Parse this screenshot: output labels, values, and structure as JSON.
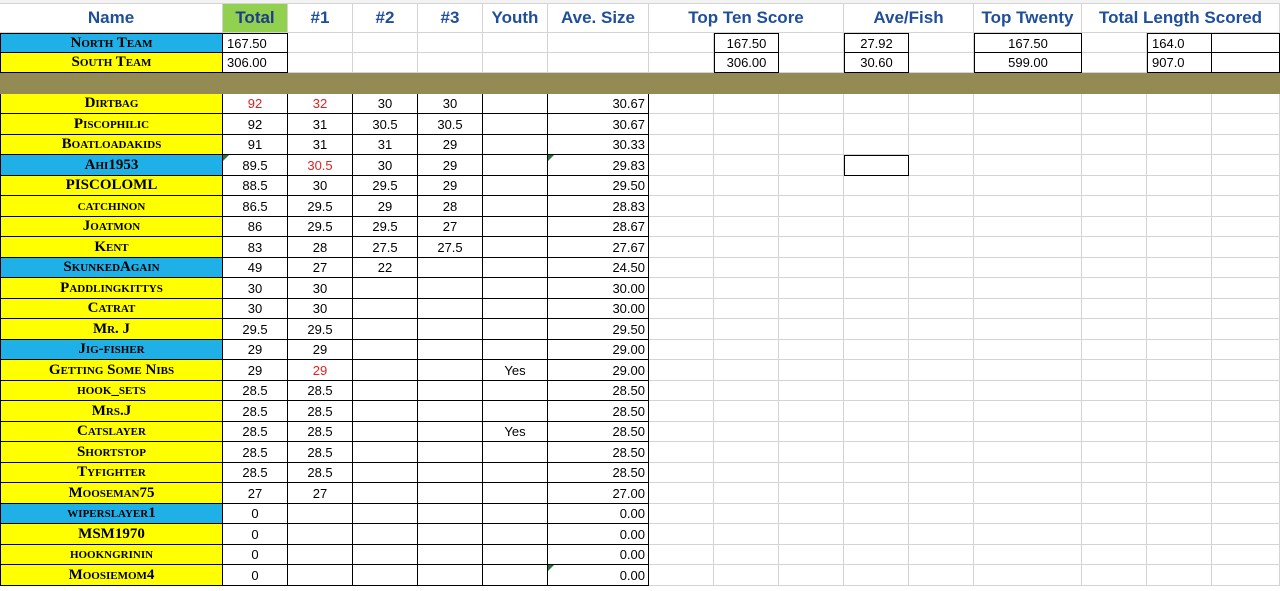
{
  "headers": {
    "name": "Name",
    "total": "Total",
    "f1": "#1",
    "f2": "#2",
    "f3": "#3",
    "youth": "Youth",
    "ave_size": "Ave. Size",
    "top_ten": "Top Ten Score",
    "ave_fish": "Ave/Fish",
    "top_twenty": "Top Twenty",
    "total_length": "Total Length Scored"
  },
  "teams": [
    {
      "name": "North Team",
      "color": "#1fb0e8",
      "total": "167.50",
      "top_ten": "167.50",
      "ave_fish": "27.92",
      "top_twenty": "167.50",
      "total_length": "164.0"
    },
    {
      "name": "South Team",
      "color": "#ffff00",
      "total": "306.00",
      "top_ten": "306.00",
      "ave_fish": "30.60",
      "top_twenty": "599.00",
      "total_length": "907.0"
    }
  ],
  "colors": {
    "north": "#1fb0e8",
    "south": "#ffff00",
    "total_header": "#92d050",
    "separator": "#948a54",
    "red_value": "#e02020",
    "header_text": "#1f4e9a"
  },
  "anglers": [
    {
      "name": "Dirtbag",
      "team": "yellow",
      "total": "92",
      "f1": "32",
      "f2": "30",
      "f3": "30",
      "youth": "",
      "ave": "30.67",
      "red_total": true,
      "red_f1": true
    },
    {
      "name": "Piscophilic",
      "team": "yellow",
      "total": "92",
      "f1": "31",
      "f2": "30.5",
      "f3": "30.5",
      "youth": "",
      "ave": "30.67"
    },
    {
      "name": "Boatloadakids",
      "team": "yellow",
      "total": "91",
      "f1": "31",
      "f2": "31",
      "f3": "29",
      "youth": "",
      "ave": "30.33"
    },
    {
      "name": "Ahi1953",
      "team": "blue",
      "total": "89.5",
      "f1": "30.5",
      "f2": "30",
      "f3": "29",
      "youth": "",
      "ave": "29.83",
      "red_f1": true,
      "tri_total": true,
      "tri_ave": true
    },
    {
      "name": "PISCOLOML",
      "team": "yellow",
      "total": "88.5",
      "f1": "30",
      "f2": "29.5",
      "f3": "29",
      "youth": "",
      "ave": "29.50"
    },
    {
      "name": "catchinon",
      "team": "yellow",
      "total": "86.5",
      "f1": "29.5",
      "f2": "29",
      "f3": "28",
      "youth": "",
      "ave": "28.83"
    },
    {
      "name": "Joatmon",
      "team": "yellow",
      "total": "86",
      "f1": "29.5",
      "f2": "29.5",
      "f3": "27",
      "youth": "",
      "ave": "28.67"
    },
    {
      "name": "Kent",
      "team": "yellow",
      "total": "83",
      "f1": "28",
      "f2": "27.5",
      "f3": "27.5",
      "youth": "",
      "ave": "27.67"
    },
    {
      "name": "SkunkedAgain",
      "team": "blue",
      "total": "49",
      "f1": "27",
      "f2": "22",
      "f3": "",
      "youth": "",
      "ave": "24.50"
    },
    {
      "name": "Paddlingkittys",
      "team": "yellow",
      "total": "30",
      "f1": "30",
      "f2": "",
      "f3": "",
      "youth": "",
      "ave": "30.00"
    },
    {
      "name": "Catrat",
      "team": "yellow",
      "total": "30",
      "f1": "30",
      "f2": "",
      "f3": "",
      "youth": "",
      "ave": "30.00"
    },
    {
      "name": "Mr. J",
      "team": "yellow",
      "total": "29.5",
      "f1": "29.5",
      "f2": "",
      "f3": "",
      "youth": "",
      "ave": "29.50"
    },
    {
      "name": "Jig-fisher",
      "team": "blue",
      "total": "29",
      "f1": "29",
      "f2": "",
      "f3": "",
      "youth": "",
      "ave": "29.00"
    },
    {
      "name": "Getting Some Nibs",
      "team": "yellow",
      "total": "29",
      "f1": "29",
      "f2": "",
      "f3": "",
      "youth": "Yes",
      "ave": "29.00",
      "red_f1": true
    },
    {
      "name": "hook_sets",
      "team": "yellow",
      "total": "28.5",
      "f1": "28.5",
      "f2": "",
      "f3": "",
      "youth": "",
      "ave": "28.50"
    },
    {
      "name": "Mrs.J",
      "team": "yellow",
      "total": "28.5",
      "f1": "28.5",
      "f2": "",
      "f3": "",
      "youth": "",
      "ave": "28.50"
    },
    {
      "name": "Catslayer",
      "team": "yellow",
      "total": "28.5",
      "f1": "28.5",
      "f2": "",
      "f3": "",
      "youth": "Yes",
      "ave": "28.50"
    },
    {
      "name": "Shortstop",
      "team": "yellow",
      "total": "28.5",
      "f1": "28.5",
      "f2": "",
      "f3": "",
      "youth": "",
      "ave": "28.50"
    },
    {
      "name": "Tyfighter",
      "team": "yellow",
      "total": "28.5",
      "f1": "28.5",
      "f2": "",
      "f3": "",
      "youth": "",
      "ave": "28.50"
    },
    {
      "name": "Mooseman75",
      "team": "yellow",
      "total": "27",
      "f1": "27",
      "f2": "",
      "f3": "",
      "youth": "",
      "ave": "27.00"
    },
    {
      "name": "wiperslayer1",
      "team": "blue",
      "total": "0",
      "f1": "",
      "f2": "",
      "f3": "",
      "youth": "",
      "ave": "0.00"
    },
    {
      "name": "MSM1970",
      "team": "yellow",
      "total": "0",
      "f1": "",
      "f2": "",
      "f3": "",
      "youth": "",
      "ave": "0.00"
    },
    {
      "name": "hookngrinin",
      "team": "yellow",
      "total": "0",
      "f1": "",
      "f2": "",
      "f3": "",
      "youth": "",
      "ave": "0.00"
    },
    {
      "name": "Moosiemom4",
      "team": "yellow",
      "total": "0",
      "f1": "",
      "f2": "",
      "f3": "",
      "youth": "",
      "ave": "0.00",
      "tri_ave": true
    }
  ]
}
